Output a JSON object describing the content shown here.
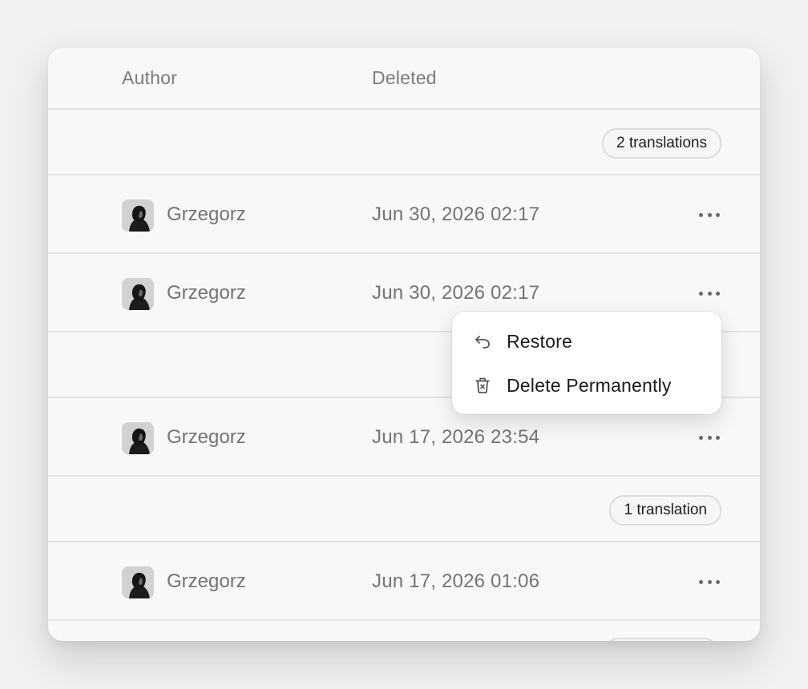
{
  "table": {
    "columns": {
      "author": "Author",
      "deleted": "Deleted"
    },
    "badges": [
      "2 translations",
      "1 translation"
    ],
    "rows": [
      {
        "author": "Grzegorz",
        "deleted": "Jun 30, 2026 02:17"
      },
      {
        "author": "Grzegorz",
        "deleted": "Jun 30, 2026 02:17"
      },
      {
        "author": "Grzegorz",
        "deleted": "Jun 17, 2026 23:54"
      },
      {
        "author": "Grzegorz",
        "deleted": "Jun 17, 2026 01:06"
      }
    ]
  },
  "menu": {
    "restore": "Restore",
    "delete_permanently": "Delete Permanently",
    "restore_icon": "undo-arrow-icon",
    "delete_icon": "trash-icon"
  },
  "colors": {
    "page_background": "#f1f1f1",
    "card_background": "#f8f8f8",
    "divider": "#e2e2e2",
    "muted_text": "#737373"
  }
}
